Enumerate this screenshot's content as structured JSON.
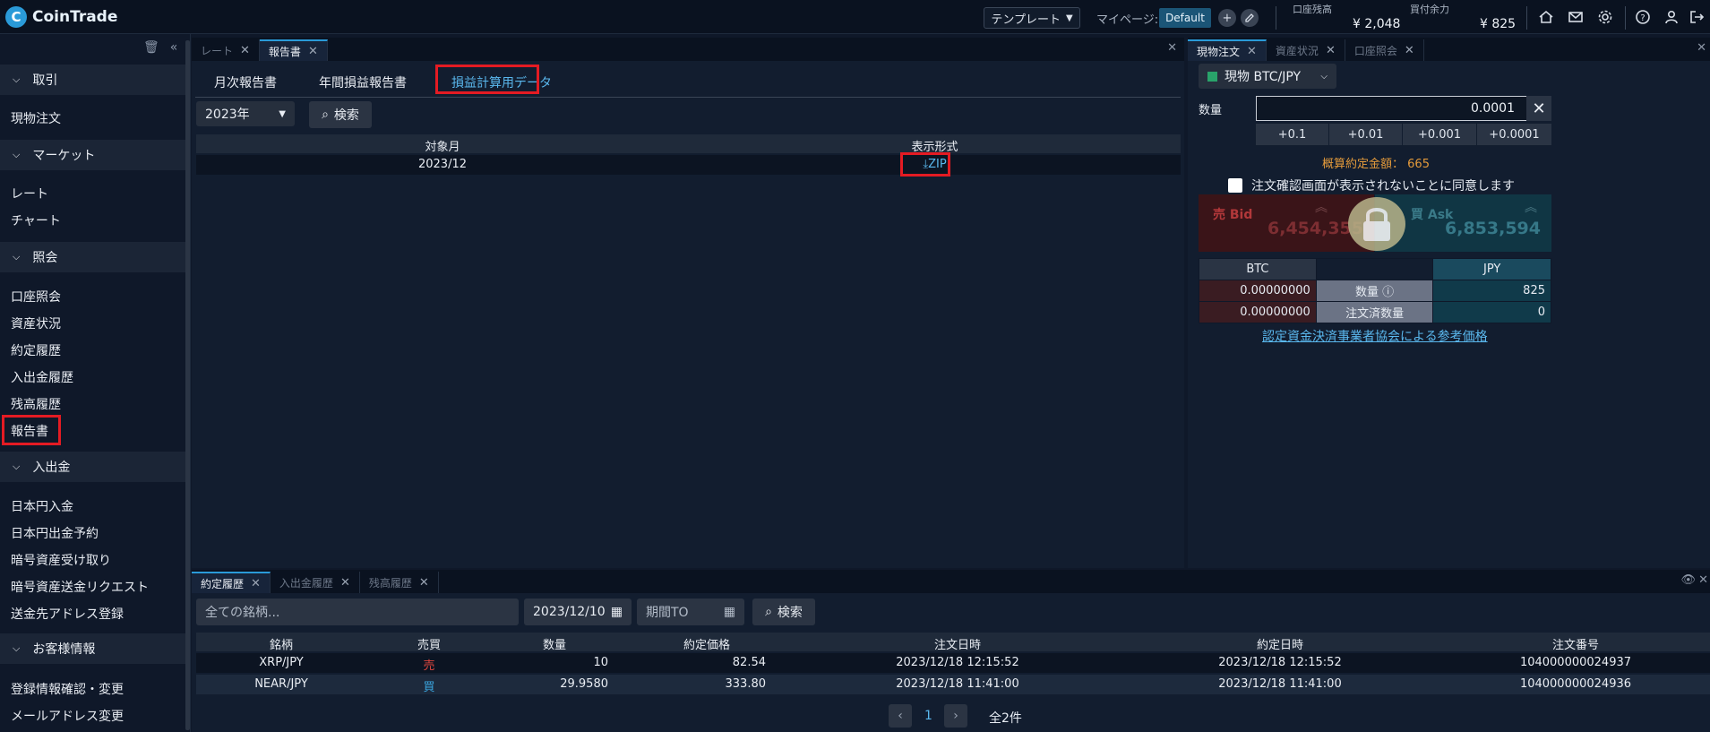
{
  "brand": {
    "logo_letter": "C",
    "name": "CoinTrade"
  },
  "topbar": {
    "template_label": "テンプレート",
    "mypage_label": "マイページ:",
    "default_label": "Default",
    "account_balance_label": "口座残高",
    "account_balance_value": "¥ 2,048",
    "buying_power_label": "買付余力",
    "buying_power_value": "¥ 825"
  },
  "sidebar": {
    "sections": [
      {
        "title": "取引",
        "items": [
          "現物注文"
        ]
      },
      {
        "title": "マーケット",
        "items": [
          "レート",
          "チャート"
        ]
      },
      {
        "title": "照会",
        "items": [
          "口座照会",
          "資産状況",
          "約定履歴",
          "入出金履歴",
          "残高履歴",
          "報告書"
        ]
      },
      {
        "title": "入出金",
        "items": [
          "日本円入金",
          "日本円出金予約",
          "暗号資産受け取り",
          "暗号資産送金リクエスト",
          "送金先アドレス登録"
        ]
      },
      {
        "title": "お客様情報",
        "items": [
          "登録情報確認・変更",
          "メールアドレス変更"
        ]
      }
    ]
  },
  "report": {
    "panel_tabs": [
      "レート",
      "報告書"
    ],
    "tabs": [
      "月次報告書",
      "年間損益報告書",
      "損益計算用データ"
    ],
    "year_select": "2023年",
    "search_label": "検索",
    "columns": [
      "対象月",
      "表示形式"
    ],
    "rows": [
      {
        "month": "2023/12",
        "format": "ZIP"
      }
    ]
  },
  "order": {
    "panel_tabs": [
      "現物注文",
      "資産状況",
      "口座照会"
    ],
    "symbol": "現物 BTC/JPY",
    "qty_label": "数量",
    "qty_value": "0.0001",
    "increments": [
      "+0.1",
      "+0.01",
      "+0.001",
      "+0.0001"
    ],
    "est_label": "概算約定金額：",
    "est_value": "665",
    "confirm_label": "注文確認画面が表示されないことに同意します",
    "bid_label": "売 Bid",
    "bid_price": "6,454,355",
    "ask_label": "買 Ask",
    "ask_price": "6,853,594",
    "bal_head_left": "BTC",
    "bal_head_right": "JPY",
    "bal_rows": [
      {
        "left": "0.00000000",
        "label": "数量",
        "right": "825"
      },
      {
        "left": "0.00000000",
        "label": "注文済数量",
        "right": "0"
      }
    ],
    "ref_link": "認定資金決済事業者協会による参考価格"
  },
  "history": {
    "panel_tabs": [
      "約定履歴",
      "入出金履歴",
      "残高履歴"
    ],
    "symbol_placeholder": "全ての銘柄...",
    "date_from": "2023/12/10",
    "date_to_placeholder": "期間TO",
    "search_label": "検索",
    "columns": [
      "銘柄",
      "売買",
      "数量",
      "約定価格",
      "注文日時",
      "約定日時",
      "注文番号"
    ],
    "rows": [
      {
        "symbol": "XRP/JPY",
        "side": "売",
        "qty": "10",
        "price": "82.54",
        "ordered": "2023/12/18 12:15:52",
        "executed": "2023/12/18 12:15:52",
        "order_no": "104000000024937"
      },
      {
        "symbol": "NEAR/JPY",
        "side": "買",
        "qty": "29.9580",
        "price": "333.80",
        "ordered": "2023/12/18 11:41:00",
        "executed": "2023/12/18 11:41:00",
        "order_no": "104000000024936"
      }
    ],
    "page": "1",
    "total": "全2件"
  },
  "colors": {
    "accent": "#2a9ad8",
    "sell": "#e0473f",
    "buy": "#3aa6e0",
    "highlight": "#e41b23",
    "est": "#e39a3b"
  }
}
